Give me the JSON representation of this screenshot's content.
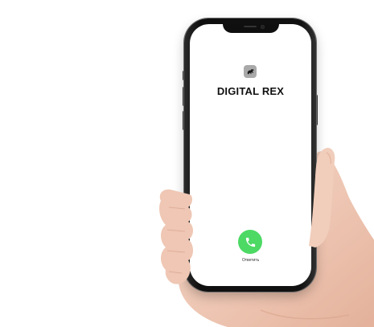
{
  "screen": {
    "caller_name": "DIGITAL REX",
    "answer_label": "Ответить"
  },
  "icons": {
    "app_icon": "dinosaur-icon",
    "answer_icon": "phone-handset-icon"
  },
  "colors": {
    "answer_button": "#4cd964",
    "app_icon_bg": "#a9a9a9",
    "phone_frame": "#111111",
    "screen_bg": "#ffffff"
  }
}
